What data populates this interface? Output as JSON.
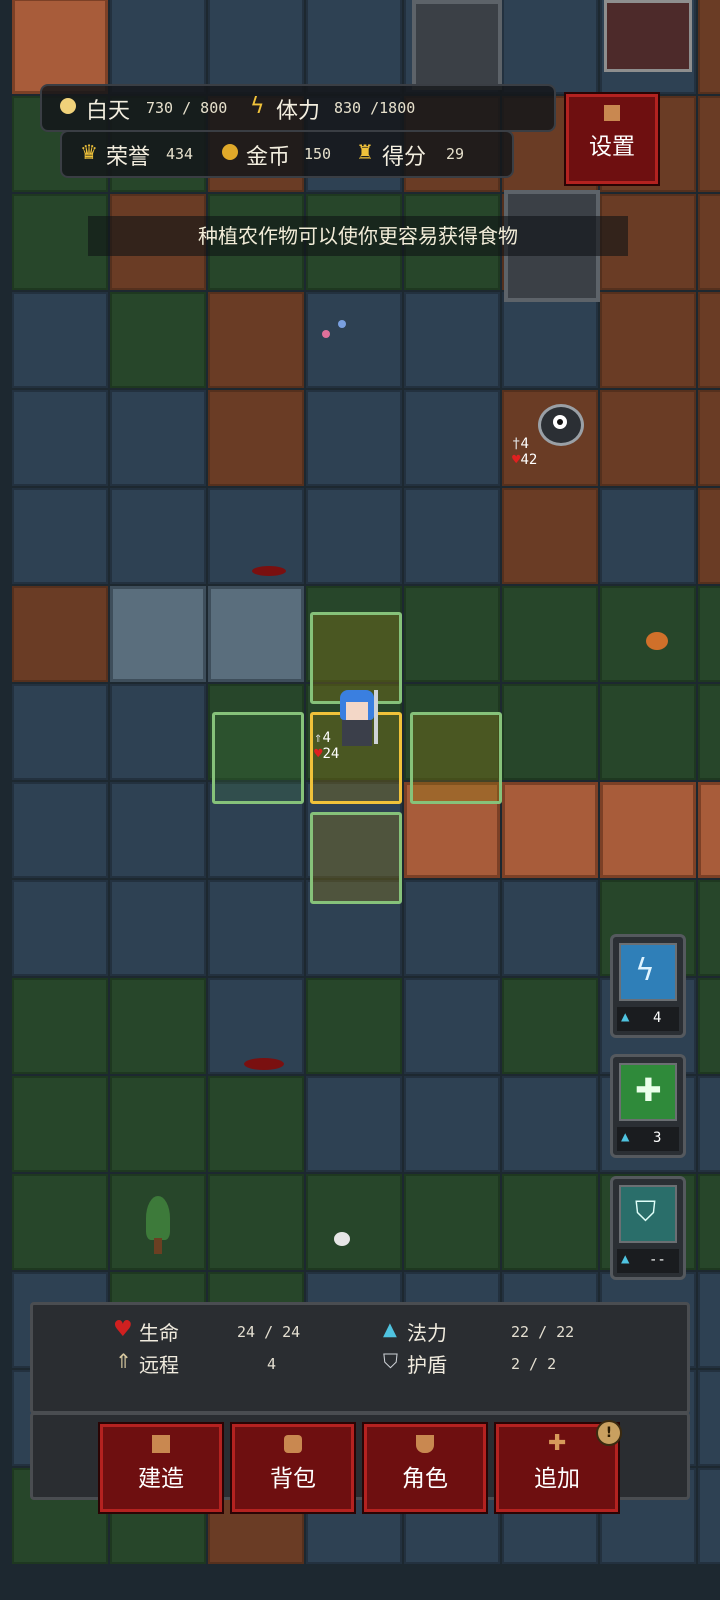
{
  "top_hud": {
    "day_label": "白天",
    "day_value": "730 / 800",
    "stamina_label": "体力",
    "stamina_value": "830 /1800",
    "honor_label": "荣誉",
    "honor_value": "434",
    "gold_label": "金币",
    "gold_value": "150",
    "score_label": "得分",
    "score_value": "29",
    "settings_label": "设置"
  },
  "hint_text": "种植农作物可以使你更容易获得食物",
  "enemy": {
    "attack": "4",
    "hp": "42"
  },
  "player": {
    "attack": "4",
    "hp": "24"
  },
  "skills": [
    {
      "name": "lightning-skill",
      "cost": "4",
      "color": "#2f7fb8"
    },
    {
      "name": "holy-cross-skill",
      "cost": "3",
      "color": "#2f8a3a"
    },
    {
      "name": "shield-skill",
      "cost": "--",
      "color": "#2a6e6a"
    }
  ],
  "stats": {
    "hp_label": "生命",
    "hp_value": "24 / 24",
    "mana_label": "法力",
    "mana_value": "22 / 22",
    "ranged_label": "远程",
    "ranged_value": "4",
    "shield_label": "护盾",
    "shield_value": "2 / 2"
  },
  "menu": {
    "build": "建造",
    "bag": "背包",
    "character": "角色",
    "extra": "追加",
    "alert_symbol": "!"
  },
  "colors": {
    "accent_red": "#6e0f10",
    "highlight_green": "#86c27a",
    "highlight_gold": "#f0c23a"
  }
}
